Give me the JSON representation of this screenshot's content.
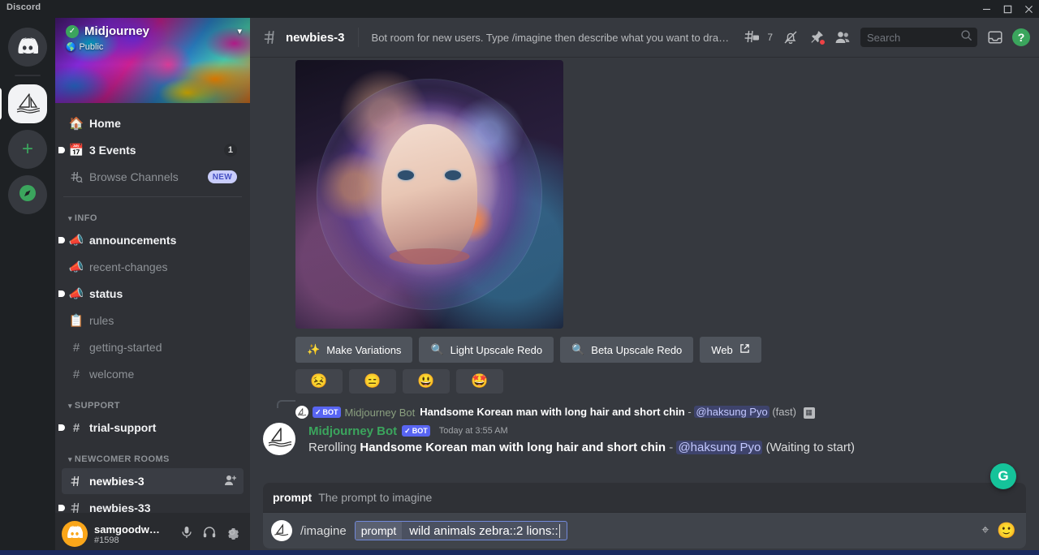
{
  "window": {
    "app_label": "Discord",
    "controls": [
      {
        "name": "minimize",
        "glyph": "–"
      },
      {
        "name": "maximize",
        "glyph": "❐"
      },
      {
        "name": "close",
        "glyph": "✕"
      }
    ]
  },
  "server_rail": [
    {
      "name": "discord-home",
      "label": "Discord",
      "icon": "discord-icon",
      "active": false
    },
    {
      "name": "server-midjourney",
      "label": "Midjourney",
      "icon": "sailboat-icon",
      "active": true
    },
    {
      "name": "add-server",
      "label": "Add a Server",
      "icon": "plus-icon",
      "active": false
    },
    {
      "name": "explore-servers",
      "label": "Explore Public Servers",
      "icon": "compass-icon",
      "active": false
    }
  ],
  "sidebar": {
    "server_name": "Midjourney",
    "verified_icon": "verified-check-icon",
    "privacy_label": "Public",
    "privacy_icon": "globe-icon",
    "chevron_icon": "chevron-down-icon",
    "nav": [
      {
        "label": "Home",
        "icon": "home-icon",
        "bold": false,
        "unread": false,
        "badge": ""
      },
      {
        "label": "3 Events",
        "icon": "calendar-icon",
        "bold": true,
        "unread": true,
        "badge": "1"
      },
      {
        "label": "Browse Channels",
        "icon": "hash-search-icon",
        "bold": false,
        "unread": false,
        "badge": "NEW"
      }
    ],
    "categories": [
      {
        "label": "INFO",
        "channels": [
          {
            "label": "announcements",
            "icon": "announcement-icon",
            "bold": true,
            "unread": true
          },
          {
            "label": "recent-changes",
            "icon": "announcement-icon",
            "bold": false,
            "unread": false
          },
          {
            "label": "status",
            "icon": "announcement-icon",
            "bold": true,
            "unread": true
          },
          {
            "label": "rules",
            "icon": "rules-icon",
            "bold": false,
            "unread": false
          },
          {
            "label": "getting-started",
            "icon": "hash-icon",
            "bold": false,
            "unread": false
          },
          {
            "label": "welcome",
            "icon": "hash-icon",
            "bold": false,
            "unread": false
          }
        ]
      },
      {
        "label": "SUPPORT",
        "channels": [
          {
            "label": "trial-support",
            "icon": "hash-icon",
            "bold": true,
            "unread": true
          }
        ]
      },
      {
        "label": "NEWCOMER ROOMS",
        "channels": [
          {
            "label": "newbies-3",
            "icon": "hash-thread-icon",
            "bold": true,
            "unread": false,
            "active": true,
            "action_icon": "add-member-icon"
          },
          {
            "label": "newbies-33",
            "icon": "hash-thread-icon",
            "bold": true,
            "unread": true
          }
        ]
      }
    ],
    "user": {
      "name": "samgoodw…",
      "tag": "#1598",
      "avatar_icon": "discord-avatar-icon",
      "actions": [
        {
          "name": "mute-button",
          "icon": "microphone-icon"
        },
        {
          "name": "deafen-button",
          "icon": "headphones-icon"
        },
        {
          "name": "user-settings-button",
          "icon": "gear-icon"
        }
      ]
    }
  },
  "chat_header": {
    "hash_icon": "hash-thread-icon",
    "channel": "newbies-3",
    "topic": "Bot room for new users. Type /imagine then describe what you want to draw. S…",
    "icons": [
      {
        "name": "threads-icon",
        "badge": "7"
      },
      {
        "name": "notification-muted-icon",
        "badge": ""
      },
      {
        "name": "pinned-messages-icon",
        "badge": "dot"
      },
      {
        "name": "member-list-icon",
        "badge": ""
      }
    ],
    "search": {
      "placeholder": "Search",
      "value": "",
      "icon": "search-icon"
    },
    "inbox_icon": "inbox-icon",
    "help_icon": "help-icon",
    "help_glyph": "?"
  },
  "messages": {
    "image_message": {
      "alt": "Generated cosmic portrait image",
      "buttons": [
        {
          "label": "Make Variations",
          "icon": "✨"
        },
        {
          "label": "Light Upscale Redo",
          "icon": "🔍"
        },
        {
          "label": "Beta Upscale Redo",
          "icon": "🔍"
        },
        {
          "label": "Web",
          "icon": "↗"
        }
      ],
      "reactions": [
        "😣",
        "😑",
        "😃",
        "🤩"
      ]
    },
    "reply_reference": {
      "bot_tag": "BOT",
      "bot_check": "✓",
      "author": "Midjourney Bot",
      "prompt": "Handsome Korean man with long hair and short chin",
      "separator": "-",
      "mention": "@haksung Pyo",
      "suffix": "(fast)",
      "attachment_icon": "image-attachment-icon"
    },
    "main_message": {
      "author": "Midjourney Bot",
      "bot_tag": "BOT",
      "bot_check": "✓",
      "timestamp": "Today at 3:55 AM",
      "prefix": "Rerolling",
      "prompt": "Handsome Korean man with long hair and short chin",
      "separator": "-",
      "mention": "@haksung Pyo",
      "status": "(Waiting to start)",
      "avatar_icon": "midjourney-sailboat-icon"
    }
  },
  "composer": {
    "autocomplete": {
      "key": "prompt",
      "description": "The prompt to imagine"
    },
    "avatar_icon": "midjourney-sailboat-icon",
    "command": "/imagine",
    "param_key": "prompt",
    "param_value": "wild animals zebra::2 lions::",
    "emoji_button_icon": "emoji-icon",
    "emoji_glyph": "🙂",
    "grammarly_icon": "grammarly-icon",
    "grammarly_glyph": "G"
  },
  "colors": {
    "brand_blurple": "#5865f2",
    "green_online": "#3ba55d",
    "bot_green": "#3ba55d",
    "danger_red": "#ed4245",
    "sidebar_bg": "#2f3136",
    "chat_bg": "#36393f",
    "rail_bg": "#1e2124",
    "composer_bg": "#40444b",
    "new_badge_bg": "#c9cdfb",
    "grammarly_green": "#15c39a"
  }
}
